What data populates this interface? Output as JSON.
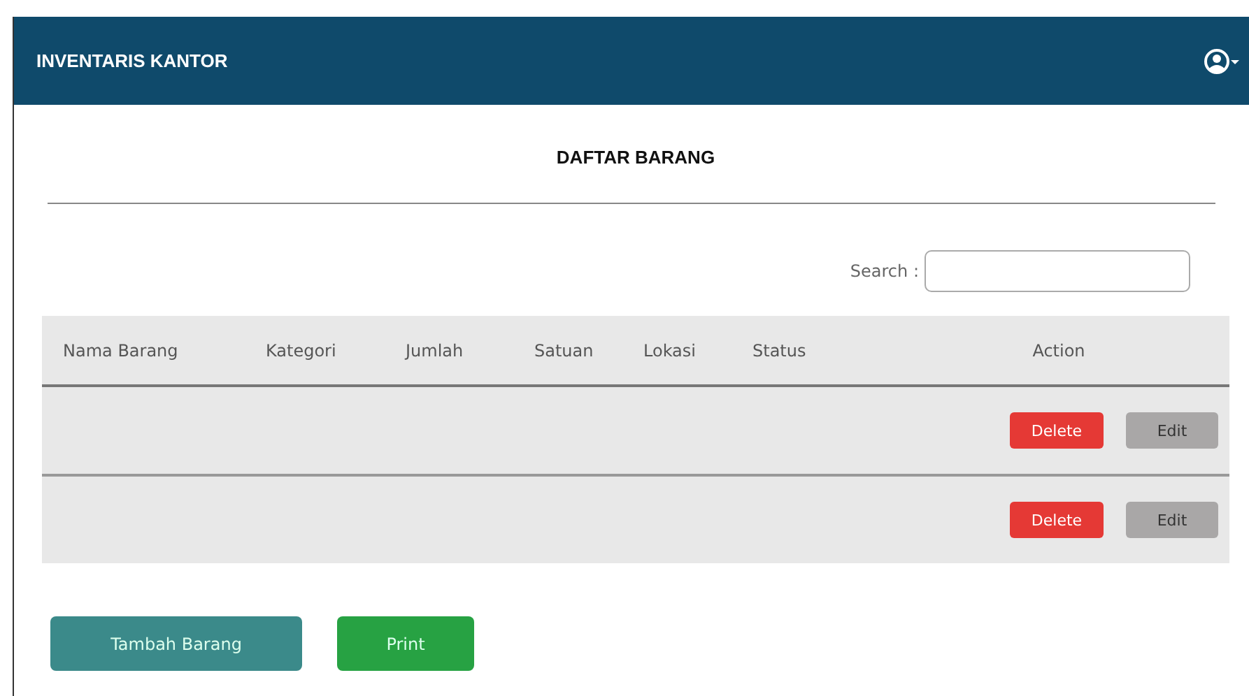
{
  "navbar": {
    "title": "INVENTARIS KANTOR"
  },
  "page": {
    "heading": "DAFTAR BARANG"
  },
  "search": {
    "label": "Search :"
  },
  "table": {
    "columns": [
      "Nama Barang",
      "Kategori",
      "Jumlah",
      "Satuan",
      "Lokasi",
      "Status",
      "Action"
    ],
    "rows": [
      {
        "delete": "Delete",
        "edit": "Edit"
      },
      {
        "delete": "Delete",
        "edit": "Edit"
      }
    ]
  },
  "buttons": [
    {
      "label": "Tambah Barang",
      "kind": "add"
    },
    {
      "label": "Print",
      "kind": "print"
    }
  ]
}
